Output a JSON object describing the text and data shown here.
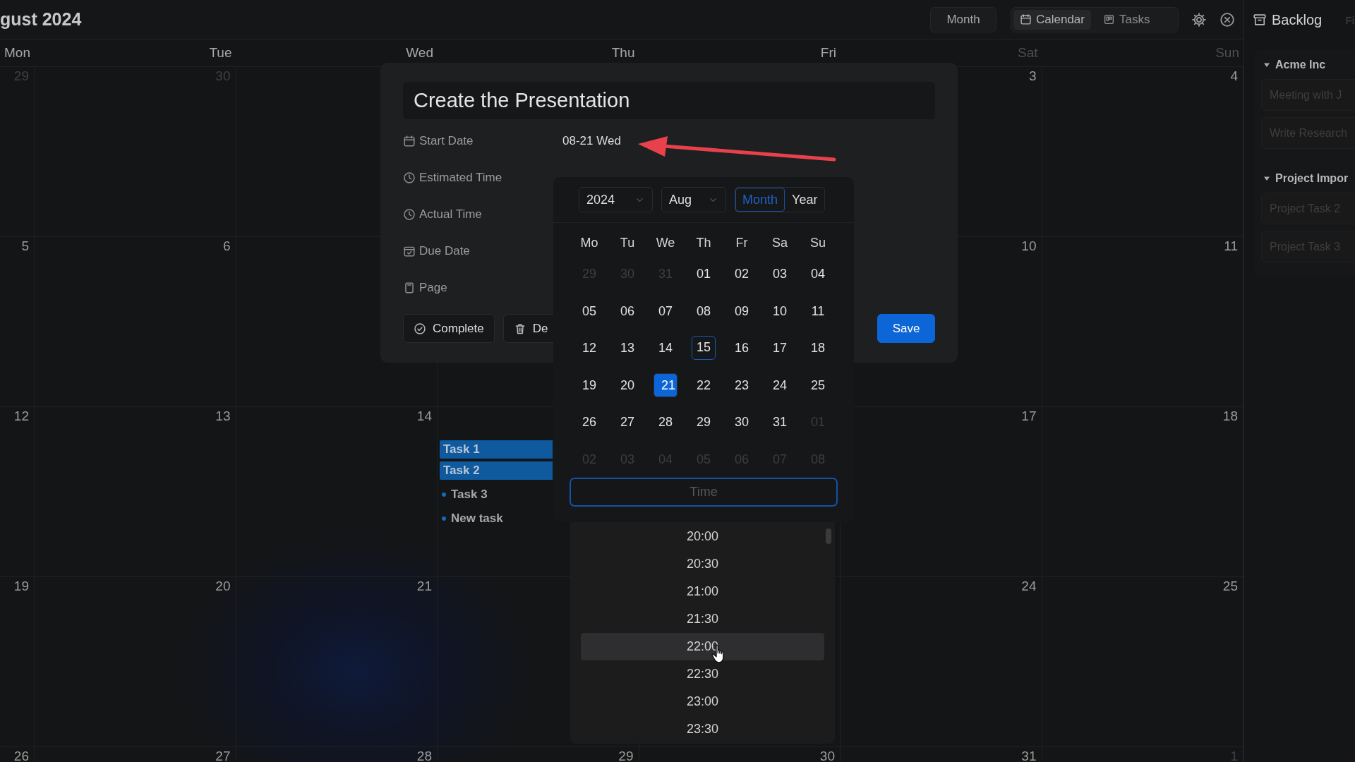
{
  "header": {
    "title": "gust 2024",
    "view_button": "Month",
    "toggle": [
      {
        "label": "Calendar",
        "kind": "calendar",
        "selected": true
      },
      {
        "label": "Tasks",
        "kind": "board",
        "selected": false
      }
    ]
  },
  "calendar": {
    "weekdays": [
      {
        "label": "Mon",
        "weekend": false
      },
      {
        "label": "Tue",
        "weekend": false
      },
      {
        "label": "Wed",
        "weekend": false
      },
      {
        "label": "Thu",
        "weekend": false
      },
      {
        "label": "Fri",
        "weekend": false
      },
      {
        "label": "Sat",
        "weekend": true
      },
      {
        "label": "Sun",
        "weekend": true
      }
    ],
    "weeks": [
      {
        "mon": {
          "day": "29",
          "muted": true
        },
        "tue": {
          "day": "30",
          "muted": true
        },
        "sat": {
          "day": "3",
          "muted": false
        },
        "sun": {
          "day": "4",
          "muted": false
        }
      },
      {
        "mon": {
          "day": "5",
          "muted": false
        },
        "tue": {
          "day": "6",
          "muted": false
        },
        "sat": {
          "day": "10",
          "muted": false
        },
        "sun": {
          "day": "11",
          "muted": false
        }
      },
      {
        "mon": {
          "day": "12",
          "muted": false
        },
        "tue": {
          "day": "13",
          "muted": false
        },
        "wed": {
          "day": "14",
          "muted": false
        },
        "thu": {
          "tasks": [
            {
              "title": "Task 1",
              "kind": "bar"
            },
            {
              "title": "Task 2",
              "kind": "bar"
            },
            {
              "title": "Task 3",
              "kind": "dot"
            },
            {
              "title": "New task",
              "kind": "dot"
            }
          ]
        },
        "sat": {
          "day": "17",
          "muted": false
        },
        "sun": {
          "day": "18",
          "muted": false
        }
      },
      {
        "mon": {
          "day": "19",
          "muted": false
        },
        "tue": {
          "day": "20",
          "muted": false
        },
        "wed": {
          "day": "21",
          "muted": false
        },
        "sat": {
          "day": "24",
          "muted": false
        },
        "sun": {
          "day": "25",
          "muted": false
        }
      },
      {
        "mon": {
          "day": "26",
          "muted": false
        },
        "tue": {
          "day": "27",
          "muted": false
        },
        "wed": {
          "day": "28",
          "muted": false
        },
        "thu": {
          "day": "29",
          "muted": false
        },
        "fri": {
          "day": "30",
          "muted": false
        },
        "sat": {
          "day": "31",
          "muted": false
        },
        "sun": {
          "day": "1",
          "muted": true
        }
      }
    ]
  },
  "sidebar": {
    "title": "Backlog",
    "tab_2": "Fi",
    "groups": [
      {
        "name": "Acme Inc",
        "expanded": true,
        "items": [
          "Meeting with J",
          "Write Research"
        ]
      },
      {
        "name": "Project Impor",
        "expanded": true,
        "items": [
          "Project Task 2",
          "Project Task 3"
        ]
      }
    ]
  },
  "dialog": {
    "title": "Create the Presentation",
    "fields": [
      {
        "label": "Start Date",
        "kind": "date",
        "value": "08-21 Wed"
      },
      {
        "label": "Estimated Time",
        "kind": "duration"
      },
      {
        "label": "Actual Time",
        "kind": "duration"
      },
      {
        "label": "Due Date",
        "kind": "due"
      },
      {
        "label": "Page",
        "kind": "page"
      }
    ],
    "buttons": [
      {
        "label": "Complete",
        "kind": "complete"
      },
      {
        "label": "De",
        "kind": "delete"
      },
      {
        "label": "Save",
        "kind": "primary"
      }
    ]
  },
  "date_picker": {
    "year": "2024",
    "month": "Aug",
    "modes": [
      {
        "label": "Month",
        "selected": true
      },
      {
        "label": "Year",
        "selected": false
      }
    ],
    "weekdays": [
      "Mo",
      "Tu",
      "We",
      "Th",
      "Fr",
      "Sa",
      "Su"
    ],
    "days": [
      {
        "day": "29",
        "muted": true,
        "today": false,
        "selected": false
      },
      {
        "day": "30",
        "muted": true,
        "today": false,
        "selected": false
      },
      {
        "day": "31",
        "muted": true,
        "today": false,
        "selected": false
      },
      {
        "day": "01",
        "muted": false,
        "today": false,
        "selected": false
      },
      {
        "day": "02",
        "muted": false,
        "today": false,
        "selected": false
      },
      {
        "day": "03",
        "muted": false,
        "today": false,
        "selected": false
      },
      {
        "day": "04",
        "muted": false,
        "today": false,
        "selected": false
      },
      {
        "day": "05",
        "muted": false,
        "today": false,
        "selected": false
      },
      {
        "day": "06",
        "muted": false,
        "today": false,
        "selected": false
      },
      {
        "day": "07",
        "muted": false,
        "today": false,
        "selected": false
      },
      {
        "day": "08",
        "muted": false,
        "today": false,
        "selected": false
      },
      {
        "day": "09",
        "muted": false,
        "today": false,
        "selected": false
      },
      {
        "day": "10",
        "muted": false,
        "today": false,
        "selected": false
      },
      {
        "day": "11",
        "muted": false,
        "today": false,
        "selected": false
      },
      {
        "day": "12",
        "muted": false,
        "today": false,
        "selected": false
      },
      {
        "day": "13",
        "muted": false,
        "today": false,
        "selected": false
      },
      {
        "day": "14",
        "muted": false,
        "today": false,
        "selected": false
      },
      {
        "day": "15",
        "muted": false,
        "today": true,
        "selected": false
      },
      {
        "day": "16",
        "muted": false,
        "today": false,
        "selected": false
      },
      {
        "day": "17",
        "muted": false,
        "today": false,
        "selected": false
      },
      {
        "day": "18",
        "muted": false,
        "today": false,
        "selected": false
      },
      {
        "day": "19",
        "muted": false,
        "today": false,
        "selected": false
      },
      {
        "day": "20",
        "muted": false,
        "today": false,
        "selected": false
      },
      {
        "day": "21",
        "muted": false,
        "today": false,
        "selected": true
      },
      {
        "day": "22",
        "muted": false,
        "today": false,
        "selected": false
      },
      {
        "day": "23",
        "muted": false,
        "today": false,
        "selected": false
      },
      {
        "day": "24",
        "muted": false,
        "today": false,
        "selected": false
      },
      {
        "day": "25",
        "muted": false,
        "today": false,
        "selected": false
      },
      {
        "day": "26",
        "muted": false,
        "today": false,
        "selected": false
      },
      {
        "day": "27",
        "muted": false,
        "today": false,
        "selected": false
      },
      {
        "day": "28",
        "muted": false,
        "today": false,
        "selected": false
      },
      {
        "day": "29",
        "muted": false,
        "today": false,
        "selected": false
      },
      {
        "day": "30",
        "muted": false,
        "today": false,
        "selected": false
      },
      {
        "day": "31",
        "muted": false,
        "today": false,
        "selected": false
      },
      {
        "day": "01",
        "muted": true,
        "today": false,
        "selected": false
      },
      {
        "day": "02",
        "muted": true,
        "today": false,
        "selected": false
      },
      {
        "day": "03",
        "muted": true,
        "today": false,
        "selected": false
      },
      {
        "day": "04",
        "muted": true,
        "today": false,
        "selected": false
      },
      {
        "day": "05",
        "muted": true,
        "today": false,
        "selected": false
      },
      {
        "day": "06",
        "muted": true,
        "today": false,
        "selected": false
      },
      {
        "day": "07",
        "muted": true,
        "today": false,
        "selected": false
      },
      {
        "day": "08",
        "muted": true,
        "today": false,
        "selected": false
      }
    ],
    "time_field": {
      "placeholder": "Time"
    },
    "time_options": [
      {
        "label": "20:00",
        "hovered": false
      },
      {
        "label": "20:30",
        "hovered": false
      },
      {
        "label": "21:00",
        "hovered": false
      },
      {
        "label": "21:30",
        "hovered": false
      },
      {
        "label": "22:00",
        "hovered": true
      },
      {
        "label": "22:30",
        "hovered": false
      },
      {
        "label": "23:00",
        "hovered": false
      },
      {
        "label": "23:30",
        "hovered": false
      }
    ]
  }
}
